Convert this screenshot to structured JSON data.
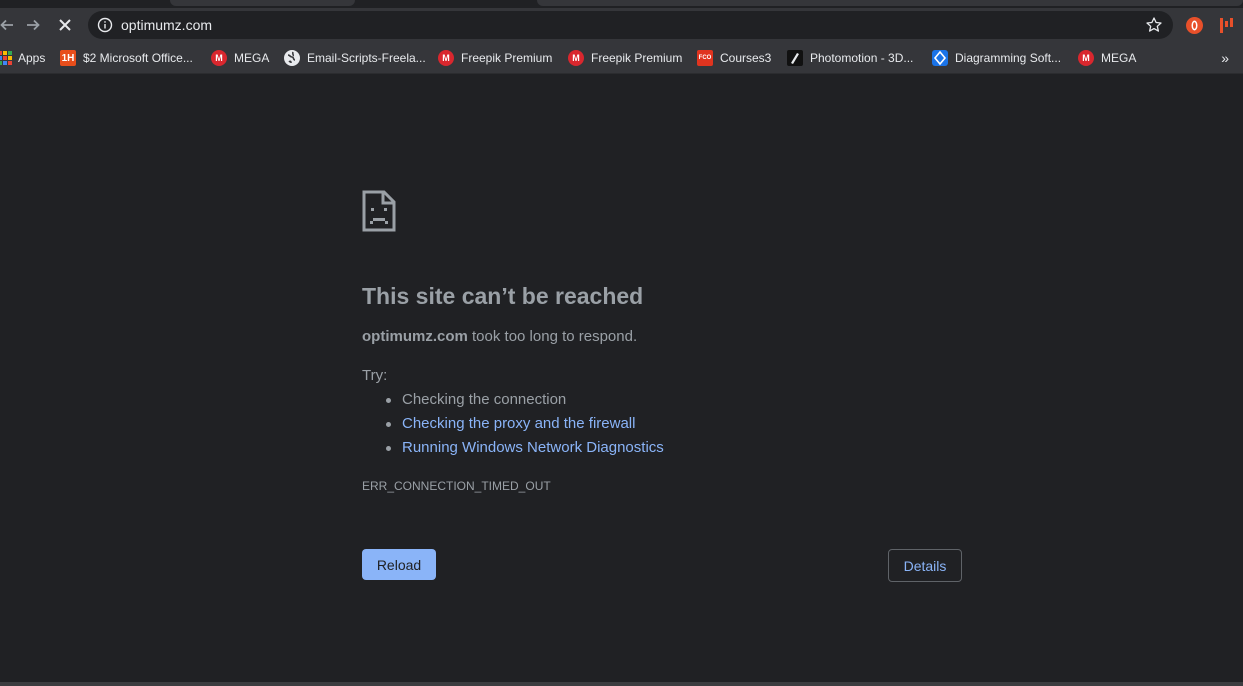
{
  "toolbar": {
    "url": "optimumz.com",
    "back_icon": "arrow-left-icon",
    "forward_icon": "arrow-right-icon",
    "stop_icon": "close-icon",
    "info_icon": "info-icon",
    "star_icon": "star-icon"
  },
  "bookmarks": [
    {
      "label": "Apps",
      "icon": "apps-grid-icon"
    },
    {
      "label": "$2 Microsoft Office...",
      "icon": "1h-icon",
      "badge": "1H"
    },
    {
      "label": "MEGA",
      "icon": "mega-icon",
      "badge": "M"
    },
    {
      "label": "Email-Scripts-Freela...",
      "icon": "globe-icon"
    },
    {
      "label": "Freepik Premium",
      "icon": "mega-icon",
      "badge": "M"
    },
    {
      "label": "Freepik Premium",
      "icon": "mega-icon",
      "badge": "M"
    },
    {
      "label": "Courses3",
      "icon": "fco-icon",
      "badge": "FCO"
    },
    {
      "label": "Photomotion - 3D...",
      "icon": "photomotion-icon"
    },
    {
      "label": "Diagramming Soft...",
      "icon": "diagramming-icon"
    },
    {
      "label": "MEGA",
      "icon": "mega-icon",
      "badge": "M"
    }
  ],
  "bookmarks_more": "»",
  "error": {
    "title": "This site can’t be reached",
    "host": "optimumz.com",
    "message": " took too long to respond.",
    "try_label": "Try:",
    "suggestions": [
      "Checking the connection",
      "Checking the proxy and the firewall",
      "Running Windows Network Diagnostics"
    ],
    "code": "ERR_CONNECTION_TIMED_OUT",
    "reload_label": "Reload",
    "details_label": "Details"
  },
  "colors": {
    "background": "#202124",
    "toolbar": "#35363a",
    "link": "#8ab4f8",
    "text": "#9aa0a6"
  }
}
